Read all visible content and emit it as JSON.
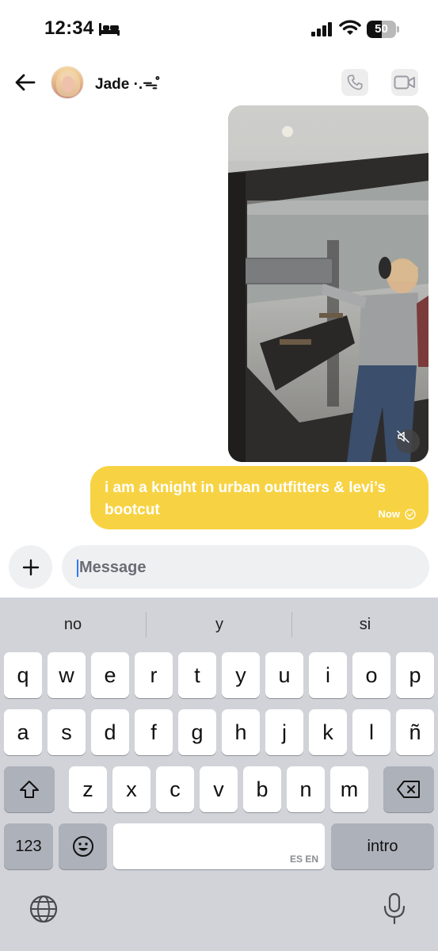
{
  "status_bar": {
    "time": "12:34",
    "battery": "50",
    "battery_level": 0.5,
    "icons": [
      "bed-icon",
      "signal-icon",
      "wifi-icon",
      "battery-icon"
    ]
  },
  "header": {
    "contact_name": "Jade ·.ᯓ̊",
    "icons": [
      "back-arrow-icon",
      "phone-icon",
      "video-camera-icon"
    ]
  },
  "media": {
    "type": "video",
    "icons": [
      "mute-icon"
    ]
  },
  "message": {
    "text": "i am a knight in urban outfitters & levi’s bootcut",
    "time": "Now",
    "icons": [
      "sent-check-icon"
    ],
    "bubble_color": "#f7d343"
  },
  "composer": {
    "placeholder": "Message",
    "icons": [
      "plus-icon"
    ]
  },
  "keyboard": {
    "suggestions": [
      "no",
      "y",
      "si"
    ],
    "row1": [
      "q",
      "w",
      "e",
      "r",
      "t",
      "y",
      "u",
      "i",
      "o",
      "p"
    ],
    "row2": [
      "a",
      "s",
      "d",
      "f",
      "g",
      "h",
      "j",
      "k",
      "l",
      "ñ"
    ],
    "row3": [
      "z",
      "x",
      "c",
      "v",
      "b",
      "n",
      "m"
    ],
    "numbers_label": "123",
    "space_languages": "ES EN",
    "return_label": "intro",
    "icons": [
      "shift-icon",
      "delete-icon",
      "emoji-icon",
      "globe-icon",
      "microphone-icon"
    ]
  }
}
